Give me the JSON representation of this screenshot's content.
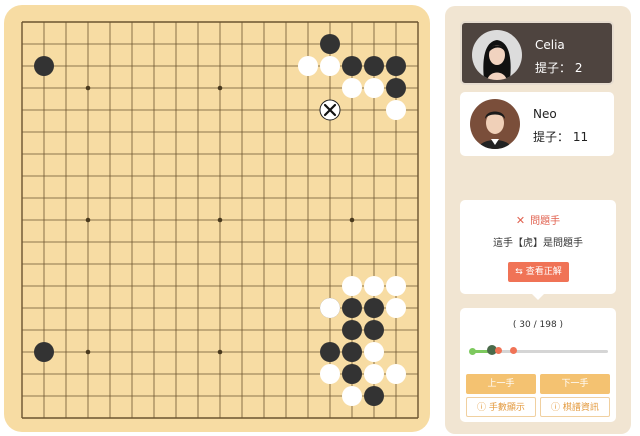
{
  "board": {
    "size": 19,
    "black_stones": [
      [
        1,
        2
      ],
      [
        14,
        1
      ],
      [
        15,
        2
      ],
      [
        16,
        2
      ],
      [
        17,
        2
      ],
      [
        17,
        3
      ],
      [
        1,
        15
      ],
      [
        14,
        13
      ],
      [
        15,
        13
      ],
      [
        16,
        13
      ],
      [
        16,
        14
      ],
      [
        15,
        14
      ],
      [
        15,
        15
      ],
      [
        14,
        15
      ],
      [
        15,
        16
      ],
      [
        16,
        17
      ]
    ],
    "white_stones": [
      [
        13,
        2
      ],
      [
        14,
        2
      ],
      [
        15,
        3
      ],
      [
        16,
        3
      ],
      [
        17,
        4
      ],
      [
        15,
        12
      ],
      [
        16,
        12
      ],
      [
        17,
        12
      ],
      [
        14,
        13
      ],
      [
        17,
        13
      ],
      [
        16,
        15
      ],
      [
        15,
        17
      ],
      [
        16,
        16
      ],
      [
        17,
        16
      ],
      [
        14,
        16
      ]
    ],
    "mistake_marker": [
      14,
      4
    ],
    "hoshi": [
      [
        3,
        3
      ],
      [
        9,
        3
      ],
      [
        15,
        3
      ],
      [
        3,
        9
      ],
      [
        9,
        9
      ],
      [
        15,
        9
      ],
      [
        3,
        15
      ],
      [
        9,
        15
      ],
      [
        15,
        15
      ]
    ],
    "line_color": "#6b5430",
    "board_color": "#f7dca3"
  },
  "players": {
    "black": {
      "name": "Celia",
      "captures_label": "提子：",
      "captures": "2",
      "active": true
    },
    "white": {
      "name": "Neo",
      "captures_label": "提子：",
      "captures": "11",
      "active": false
    }
  },
  "mistake": {
    "title": "問題手",
    "text": "這手【虎】是問題手",
    "show_answer": "查看正解",
    "color": "#e0604e"
  },
  "navigation": {
    "move_counter": "( 30 / 198 )",
    "current_move": 30,
    "total_moves": 198,
    "prev_label": "上一手",
    "next_label": "下一手",
    "show_moves_label": "手數顯示",
    "game_info_label": "棋譜資訊"
  }
}
